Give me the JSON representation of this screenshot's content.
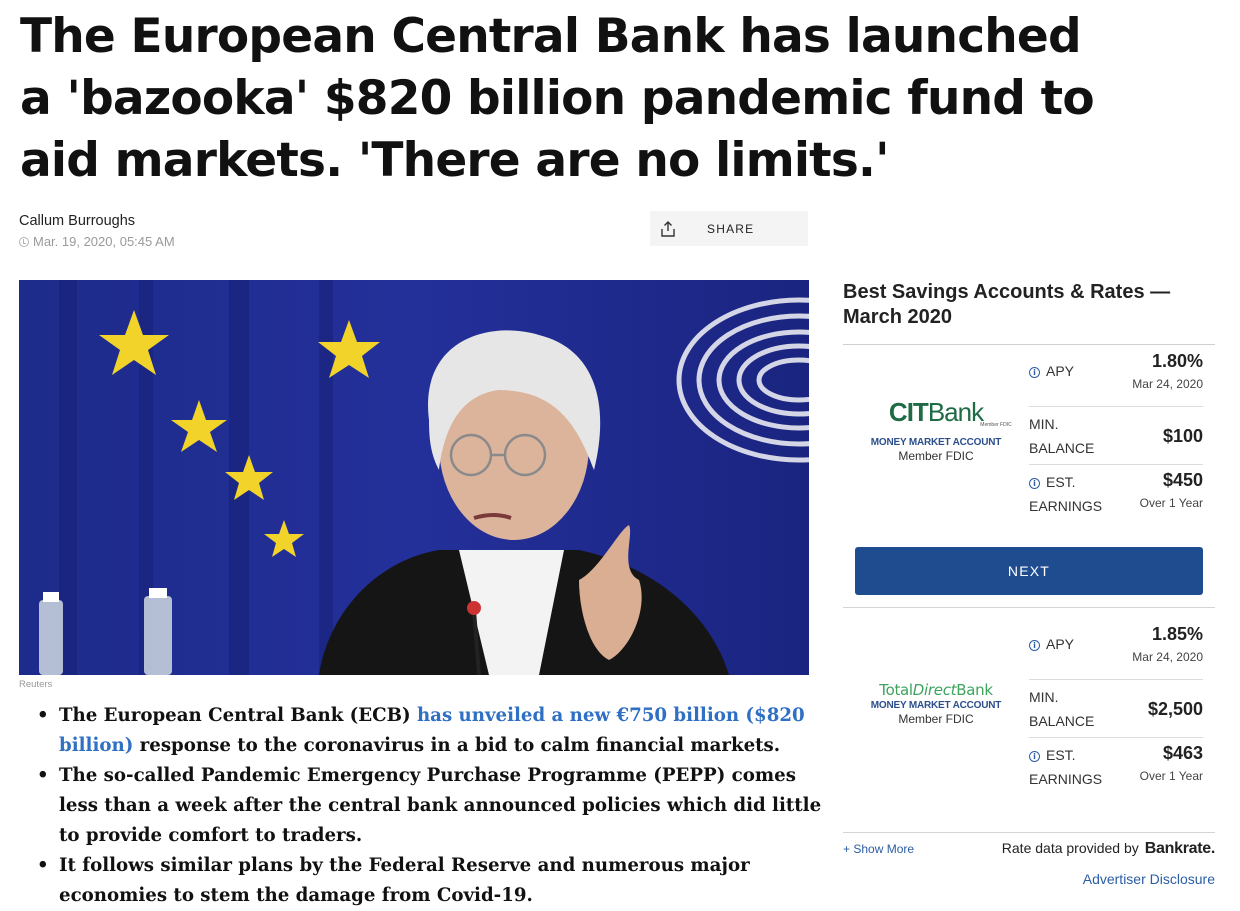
{
  "article": {
    "headline": "The European Central Bank has launched a 'bazooka' $820 billion pandemic fund to aid markets. 'There are no limits.'",
    "author": "Callum Burroughs",
    "date": "Mar. 19, 2020, 05:45 AM",
    "share_label": "SHARE",
    "image_credit": "Reuters",
    "bullets": [
      {
        "before": "The European Central Bank (ECB) ",
        "link": "has unveiled a new €750 billion ($820 billion)",
        "after": " response to the coronavirus in a bid to calm financial markets."
      },
      {
        "text": "The so-called Pandemic Emergency Purchase Programme (PEPP) comes less than a week after the central bank announced policies which did little to provide comfort to traders."
      },
      {
        "text": "It follows similar plans by the Federal Reserve and numerous major economies to stem the damage from Covid-19."
      }
    ]
  },
  "sidebar": {
    "title": "Best Savings Accounts & Rates — March 2020",
    "accounts": [
      {
        "bank_logo_text_1": "CIT",
        "bank_logo_text_2": "Bank",
        "bank_logo_small": "Member FDIC",
        "account_type": "MONEY MARKET ACCOUNT",
        "member": "Member FDIC",
        "apy_label": "APY",
        "apy_value": "1.80%",
        "apy_date": "Mar 24, 2020",
        "min_label_1": "MIN.",
        "min_label_2": "BALANCE",
        "min_value": "$100",
        "est_label_1": "EST.",
        "est_label_2": "EARNINGS",
        "est_value": "$450",
        "est_sub": "Over 1 Year"
      },
      {
        "bank_logo_text_1": "Total",
        "bank_logo_text_2": "Direct",
        "bank_logo_text_3": "Bank",
        "account_type": "MONEY MARKET ACCOUNT",
        "member": "Member FDIC",
        "apy_label": "APY",
        "apy_value": "1.85%",
        "apy_date": "Mar 24, 2020",
        "min_label_1": "MIN.",
        "min_label_2": "BALANCE",
        "min_value": "$2,500",
        "est_label_1": "EST.",
        "est_label_2": "EARNINGS",
        "est_value": "$463",
        "est_sub": "Over 1 Year"
      }
    ],
    "next_label": "NEXT",
    "show_more": "+ Show More",
    "provided_by": "Rate data provided by",
    "provider": "Bankrate",
    "provider_suffix": ".",
    "disclosure": "Advertiser Disclosure"
  },
  "colors": {
    "link": "#2f6fc4",
    "button": "#1f4c8f",
    "cit_green": "#1f6b45",
    "tdb_green": "#3da35d"
  }
}
